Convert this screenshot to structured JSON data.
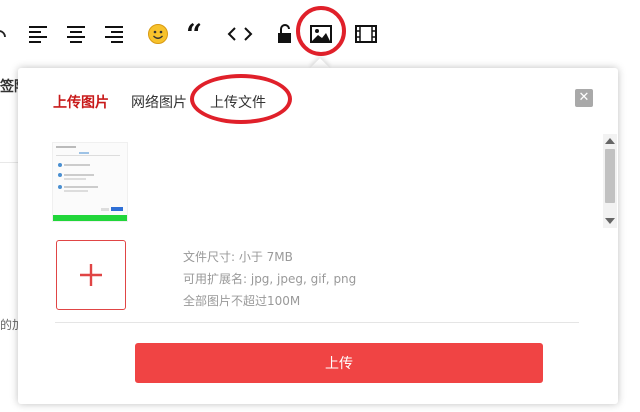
{
  "toolbar": {
    "items": [
      {
        "name": "redo-icon"
      },
      {
        "name": "align-left-icon"
      },
      {
        "name": "align-center-icon"
      },
      {
        "name": "align-right-icon"
      },
      {
        "name": "emoji-icon"
      },
      {
        "name": "quote-icon"
      },
      {
        "name": "code-icon"
      },
      {
        "name": "lock-icon"
      },
      {
        "name": "image-icon",
        "active": true
      },
      {
        "name": "video-icon"
      }
    ],
    "highlight_color": "#e0202a"
  },
  "background": {
    "fragments": [
      "签陷",
      "的加"
    ]
  },
  "dialog": {
    "tabs": [
      {
        "label": "上传图片",
        "active": true
      },
      {
        "label": "网络图片",
        "active": false
      },
      {
        "label": "上传文件",
        "active": false
      }
    ],
    "close_label": "✕",
    "add_label": "+",
    "info": {
      "size": "文件尺寸: 小于 7MB",
      "extensions": "可用扩展名: jpg, jpeg, gif, png",
      "total": "全部图片不超过100M"
    },
    "upload_label": "上传",
    "colors": {
      "accent": "#c81a1a",
      "button": "#f04444",
      "ring": "#e0202a"
    }
  }
}
